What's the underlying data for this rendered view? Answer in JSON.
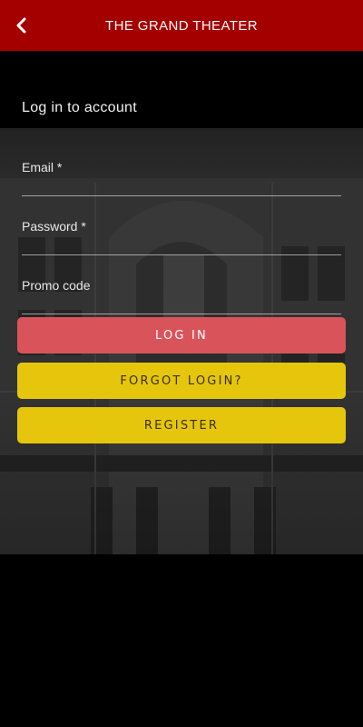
{
  "app_bar": {
    "title": "THE GRAND THEATER",
    "back_icon": "chevron-left-icon",
    "color": "#a50000"
  },
  "login": {
    "heading": "Log in to account",
    "fields": {
      "email_label": "Email *",
      "password_label": "Password *",
      "promo_label": "Promo code"
    },
    "buttons": {
      "login": "LOG IN",
      "forgot": "FORGOT LOGIN?",
      "register": "REGISTER"
    }
  },
  "colors": {
    "login_button": "#d9545a",
    "secondary_button": "#e6c60d"
  }
}
